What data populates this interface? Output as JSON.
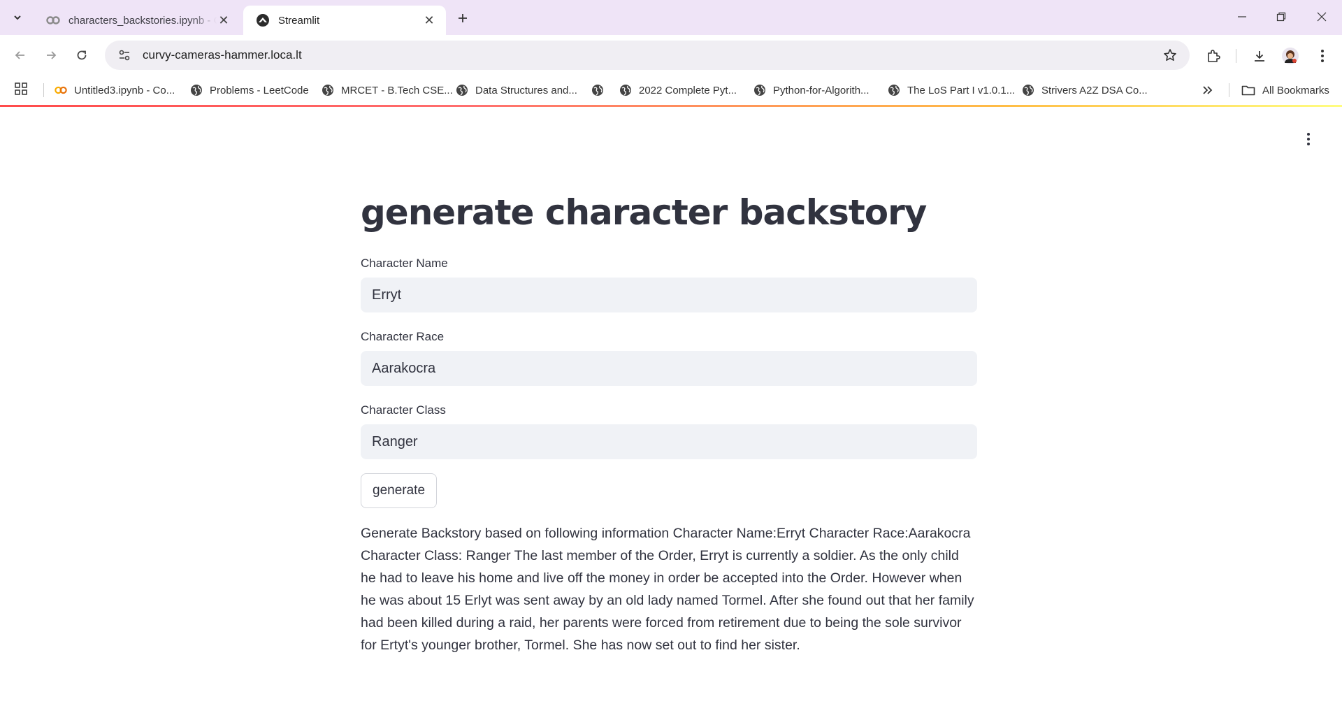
{
  "browser": {
    "tabs": [
      {
        "title": "characters_backstories.ipynb - C",
        "icon": "colab-icon"
      },
      {
        "title": "Streamlit",
        "icon": "streamlit-icon"
      }
    ],
    "url": "curvy-cameras-hammer.loca.lt",
    "bookmarks": [
      {
        "label": "Untitled3.ipynb - Co...",
        "icon": "colab-icon"
      },
      {
        "label": "Problems - LeetCode",
        "icon": "globe-icon"
      },
      {
        "label": "MRCET - B.Tech CSE...",
        "icon": "globe-icon"
      },
      {
        "label": "Data Structures and...",
        "icon": "globe-icon"
      },
      {
        "label": "",
        "icon": "globe-icon"
      },
      {
        "label": "2022 Complete Pyt...",
        "icon": "globe-icon"
      },
      {
        "label": "Python-for-Algorith...",
        "icon": "globe-icon"
      },
      {
        "label": "The LoS Part I v1.0.1...",
        "icon": "globe-icon"
      },
      {
        "label": "Strivers A2Z DSA Co...",
        "icon": "globe-icon"
      }
    ],
    "all_bookmarks_label": "All Bookmarks",
    "accent_color": "#ff4b4b"
  },
  "app": {
    "title": "generate character backstory",
    "fields": [
      {
        "label": "Character Name",
        "value": "Erryt"
      },
      {
        "label": "Character Race",
        "value": "Aarakocra"
      },
      {
        "label": "Character Class",
        "value": "Ranger"
      }
    ],
    "button_label": "generate",
    "output_text": "Generate Backstory based on following information Character Name:Erryt Character Race:Aarakocra Character Class: Ranger The last member of the Order, Erryt is currently a soldier. As the only child he had to leave his home and live off the money in order be accepted into the Order. However when he was about 15 Erlyt was sent away by an old lady named Tormel. After she found out that her family had been killed during a raid, her parents were forced from retirement due to being the sole survivor for Ertyt's younger brother, Tormel. She has now set out to find her sister."
  }
}
